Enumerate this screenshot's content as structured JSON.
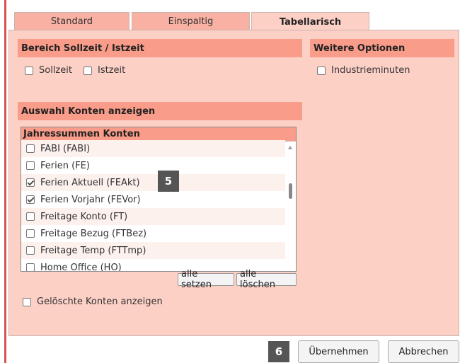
{
  "tabs": [
    {
      "label": "Standard",
      "active": false
    },
    {
      "label": "Einspaltig",
      "active": false
    },
    {
      "label": "Tabellarisch",
      "active": true
    }
  ],
  "section_sollzeit": {
    "title": "Bereich Sollzeit / Istzeit",
    "options": [
      {
        "label": "Sollzeit",
        "checked": false
      },
      {
        "label": "Istzeit",
        "checked": false
      }
    ]
  },
  "section_weitere": {
    "title": "Weitere Optionen",
    "options": [
      {
        "label": "Industrieminuten",
        "checked": false
      }
    ]
  },
  "section_konten": {
    "title": "Auswahl Konten anzeigen",
    "list_header": "Jahressummen Konten",
    "items": [
      {
        "label": "FABI (FABI)",
        "checked": false
      },
      {
        "label": "Ferien (FE)",
        "checked": false
      },
      {
        "label": "Ferien Aktuell (FEAkt)",
        "checked": true
      },
      {
        "label": "Ferien Vorjahr (FEVor)",
        "checked": true
      },
      {
        "label": "Freitage Konto (FT)",
        "checked": false
      },
      {
        "label": "Freitage Bezug (FTBez)",
        "checked": false
      },
      {
        "label": "Freitage Temp (FTTmp)",
        "checked": false
      },
      {
        "label": "Home Office (HO)",
        "checked": false
      }
    ],
    "set_all_label": "alle setzen",
    "clear_all_label": "alle löschen",
    "show_deleted": {
      "label": "Gelöschte Konten anzeigen",
      "checked": false
    }
  },
  "footer": {
    "apply_label": "Übernehmen",
    "cancel_label": "Abbrechen"
  },
  "markers": {
    "list_marker": "5",
    "footer_marker": "6"
  },
  "colors": {
    "panel_bg": "#fdd0c6",
    "header_bg": "#f99c89",
    "tab_bg": "#f9b1a3",
    "frame_accent": "#d9534f",
    "marker_bg": "#555555"
  }
}
